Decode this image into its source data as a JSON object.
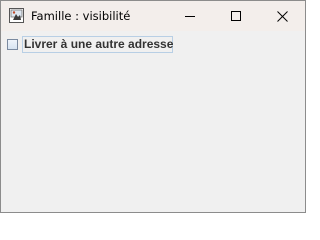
{
  "window": {
    "title": "Famille : visibilité",
    "app_icon": "java-app-icon",
    "controls": {
      "minimize_icon": "minimize-icon",
      "maximize_icon": "maximize-icon",
      "close_icon": "close-icon"
    }
  },
  "content": {
    "checkbox": {
      "label": "Livrer à une autre adresse",
      "checked": false
    }
  }
}
